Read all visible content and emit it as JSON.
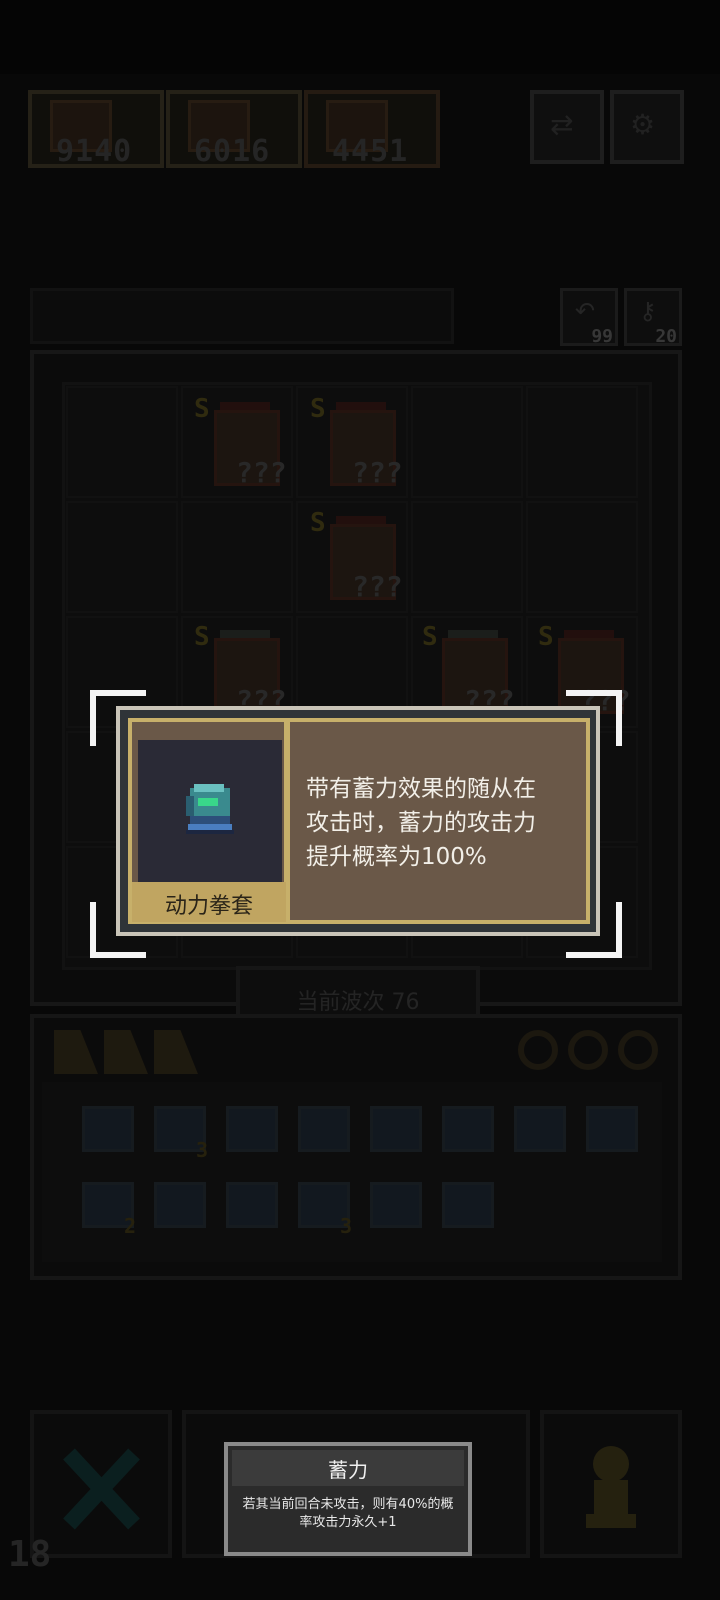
{
  "top_scores": [
    "9140",
    "6016",
    "4451"
  ],
  "keys": {
    "undo_count": "99",
    "key_count": "20"
  },
  "board_units": [
    {
      "star": "S",
      "q": "???"
    },
    {
      "star": "S",
      "q": "???"
    },
    {
      "star": "S",
      "q": "???"
    },
    {
      "star": "S",
      "q": "???"
    },
    {
      "star": "S",
      "q": "???"
    },
    {
      "star": "S",
      "q": "???"
    }
  ],
  "wave": {
    "label": "当前波次 76"
  },
  "inventory": {
    "counts": [
      "3",
      "2",
      "3"
    ]
  },
  "bottom": {
    "wave_counter": "18"
  },
  "item_popup": {
    "name": "动力拳套",
    "description": "带有蓄力效果的随从在攻击时，蓄力的攻击力提升概率为100%"
  },
  "tooltip": {
    "title": "蓄力",
    "body": "若其当前回合未攻击，则有40%的概率攻击力永久+1"
  },
  "colors": {
    "popup_gold": "#c7b06a",
    "popup_brown": "#6a5848",
    "name_plate": "#c0a561"
  }
}
